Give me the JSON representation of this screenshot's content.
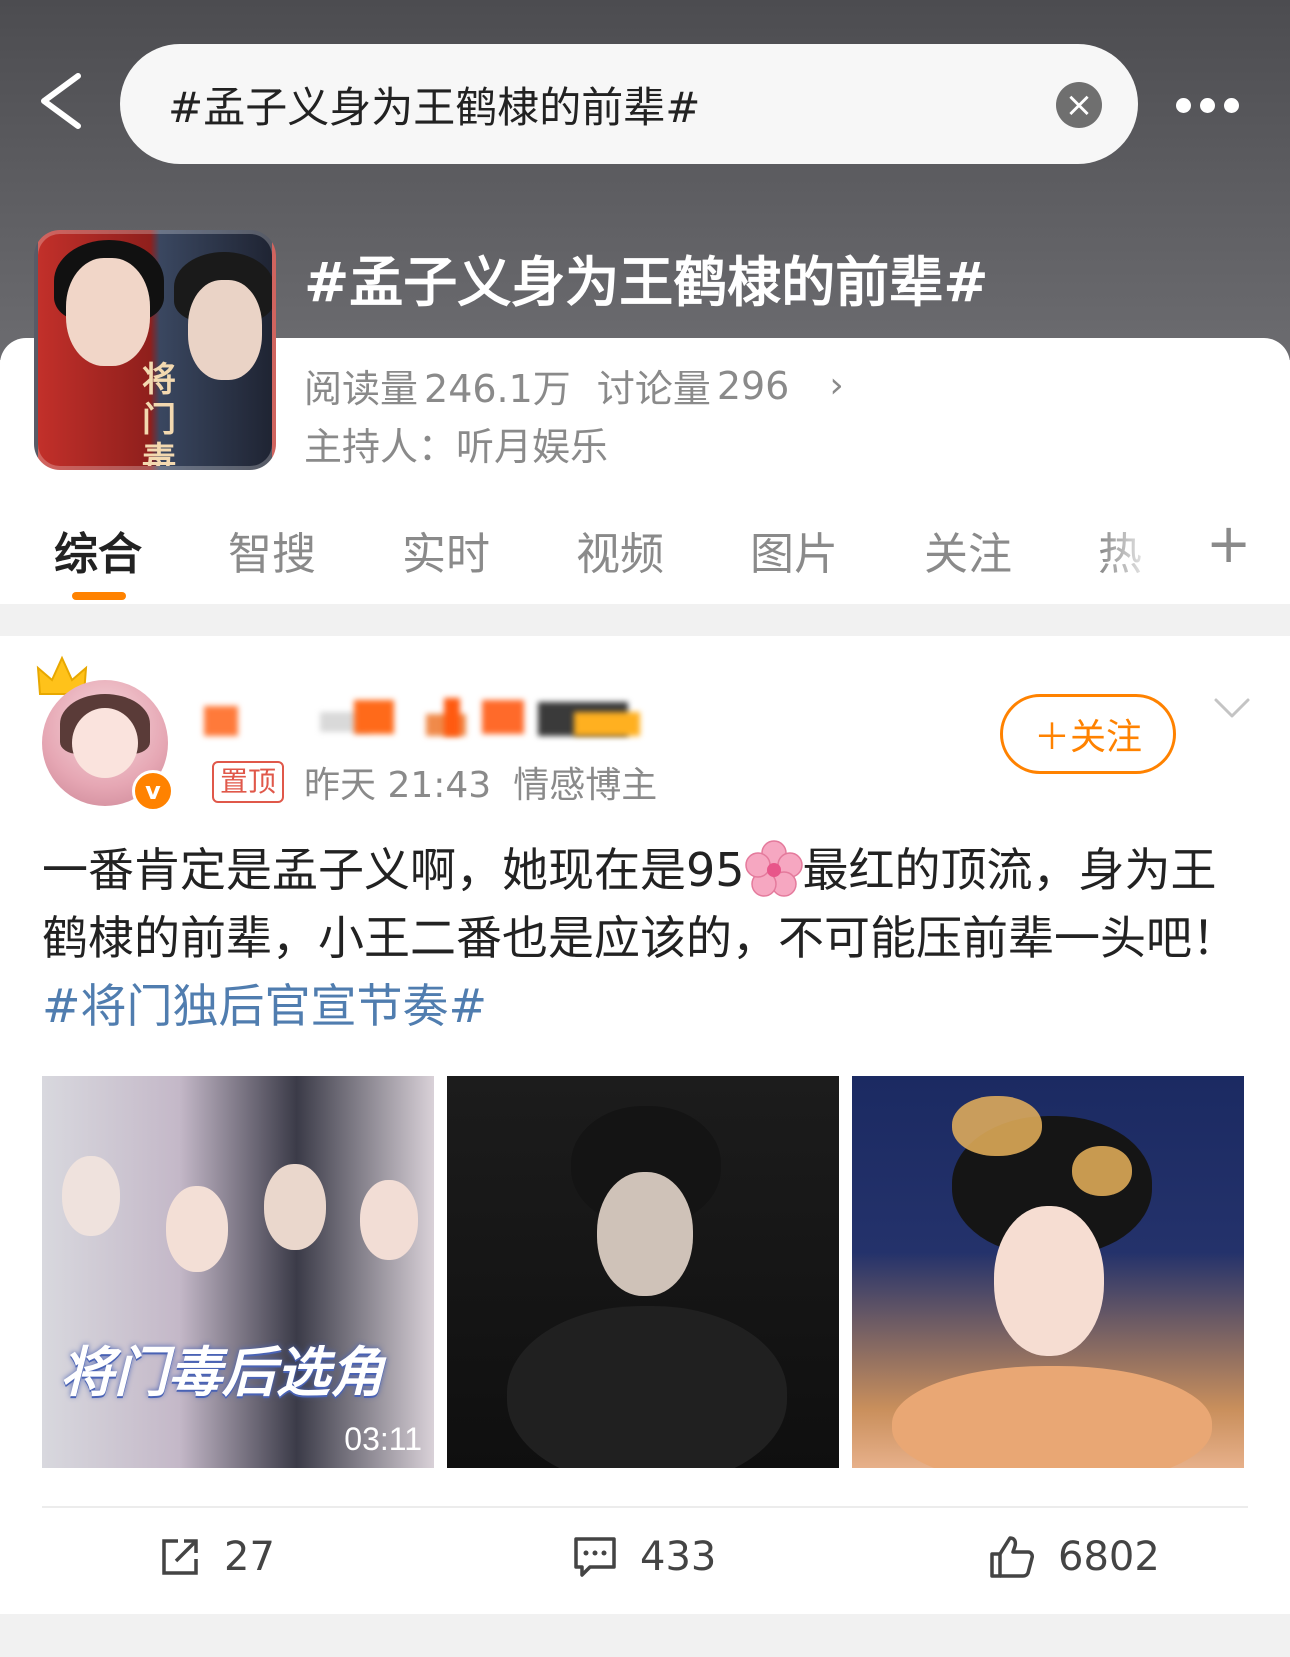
{
  "search": {
    "query": "#孟子义身为王鹤棣的前辈#",
    "clear_icon": "close-circle-icon"
  },
  "topic": {
    "title": "#孟子义身为王鹤棣的前辈#",
    "cover_text": "将门毒",
    "reads_label": "阅读量",
    "reads": "246.1万",
    "discussions_label": "讨论量",
    "discussions": "296",
    "host_label": "主持人：",
    "host": "听月娱乐"
  },
  "tabs": [
    "综合",
    "智搜",
    "实时",
    "视频",
    "图片",
    "关注",
    "热"
  ],
  "post": {
    "pinned": "置顶",
    "time": "昨天 21:43",
    "category": "情感博主",
    "follow_label": "＋关注",
    "text_before": "一番肯定是孟子义啊，她现在是95",
    "text_after": "最红的顶流，身为王鹤棣的前辈，小王二番也是应该的，不可能压前辈一头吧！",
    "hashtag": "#将门独后官宣节奏#",
    "image1_caption": "将门毒后选角",
    "video_duration": "03:11",
    "reposts": "27",
    "comments": "433",
    "likes": "6802"
  },
  "colors": {
    "accent": "#ff8200",
    "link": "#507daf",
    "pin": "#e0584a"
  }
}
